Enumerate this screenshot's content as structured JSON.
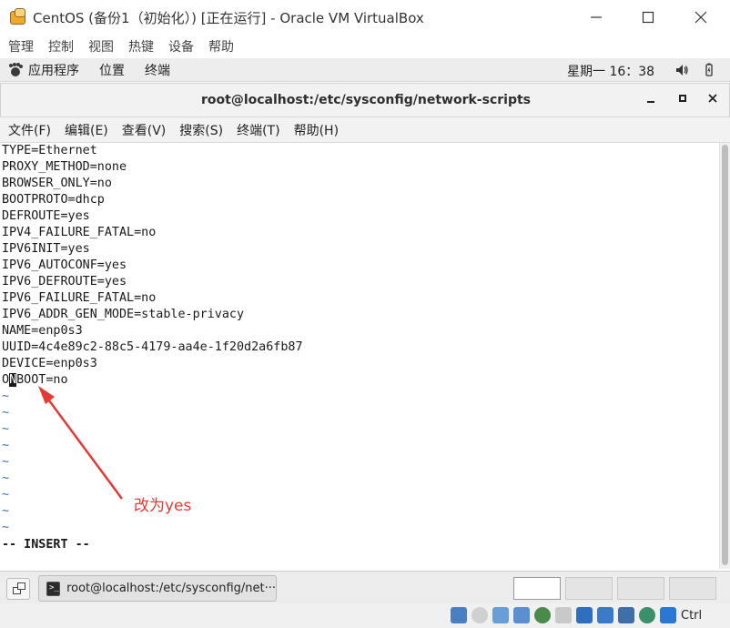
{
  "vbox_window": {
    "title": "CentOS (备份1（初始化）) [正在运行] - Oracle VM VirtualBox",
    "menu": [
      "管理",
      "控制",
      "视图",
      "热键",
      "设备",
      "帮助"
    ]
  },
  "gnome_top": {
    "applications": "应用程序",
    "places": "位置",
    "terminal": "终端",
    "clock": "星期一 16：38"
  },
  "terminal": {
    "title": "root@localhost:/etc/sysconfig/network-scripts",
    "menu": [
      "文件(F)",
      "编辑(E)",
      "查看(V)",
      "搜索(S)",
      "终端(T)",
      "帮助(H)"
    ],
    "lines": [
      "TYPE=Ethernet",
      "PROXY_METHOD=none",
      "BROWSER_ONLY=no",
      "BOOTPROTO=dhcp",
      "DEFROUTE=yes",
      "IPV4_FAILURE_FATAL=no",
      "IPV6INIT=yes",
      "IPV6_AUTOCONF=yes",
      "IPV6_DEFROUTE=yes",
      "IPV6_FAILURE_FATAL=no",
      "IPV6_ADDR_GEN_MODE=stable-privacy",
      "NAME=enp0s3",
      "UUID=4c4e89c2-88c5-4179-aa4e-1f20d2a6fb87",
      "DEVICE=enp0s3"
    ],
    "onboot_line": {
      "before": "O",
      "cursor_char": "N",
      "after": "BOOT=no"
    },
    "tilde": "~",
    "mode_line": "-- INSERT --"
  },
  "annotation": {
    "text": "改为yes",
    "color": "#e53935"
  },
  "taskbar": {
    "task_label": "root@localhost:/etc/sysconfig/net···"
  },
  "vbox_status": {
    "host_key": "Ctrl"
  }
}
